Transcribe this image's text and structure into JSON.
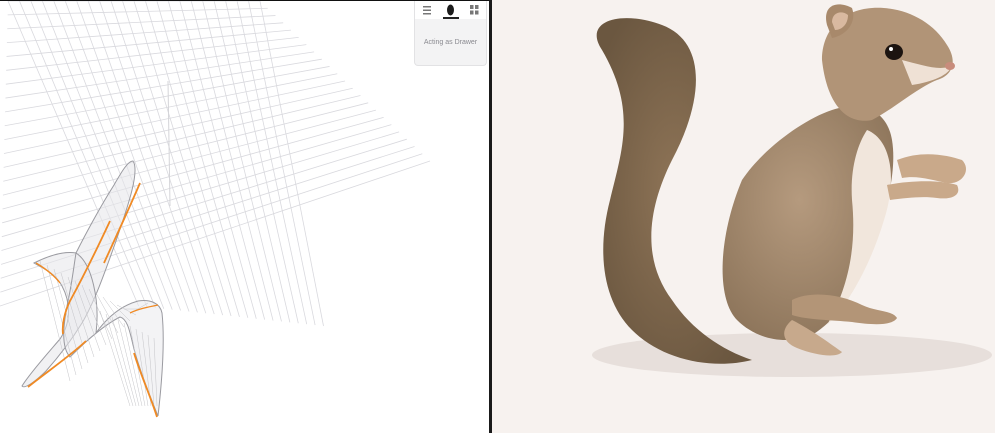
{
  "toolbar": {
    "tabs": [
      {
        "icon": "list-icon"
      },
      {
        "icon": "figure-icon",
        "active": true
      },
      {
        "icon": "grid-icon"
      }
    ],
    "drawer_hint": "Acting as Drawer"
  },
  "colors": {
    "accent_curve": "#f08a24",
    "grid_line": "#d9d9de",
    "surface_stroke": "#9a9aa0",
    "pane_divider": "#1a1a1a",
    "preview_background": "#f7f2ef"
  },
  "preview": {
    "subject_icon": "squirrel-illustration"
  }
}
